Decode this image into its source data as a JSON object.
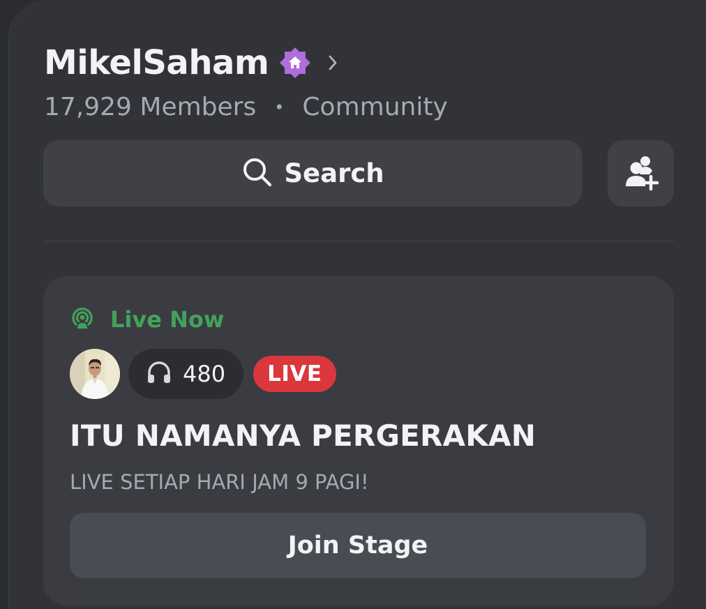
{
  "server": {
    "name": "MikelSaham",
    "member_count": "17,929 Members",
    "separator": "•",
    "type": "Community",
    "badge_icon": "community-home-badge-icon",
    "badge_color": "#b06ddb"
  },
  "actions": {
    "search_label": "Search",
    "search_icon": "search-icon",
    "invite_icon": "add-member-icon"
  },
  "stage": {
    "status_label": "Live Now",
    "status_color": "#43a25a",
    "listener_count": "480",
    "live_badge": "LIVE",
    "live_badge_color": "#da373c",
    "title": "ITU NAMANYA PERGERAKAN",
    "description": "LIVE SETIAP HARI JAM 9 PAGI!",
    "join_label": "Join Stage"
  }
}
